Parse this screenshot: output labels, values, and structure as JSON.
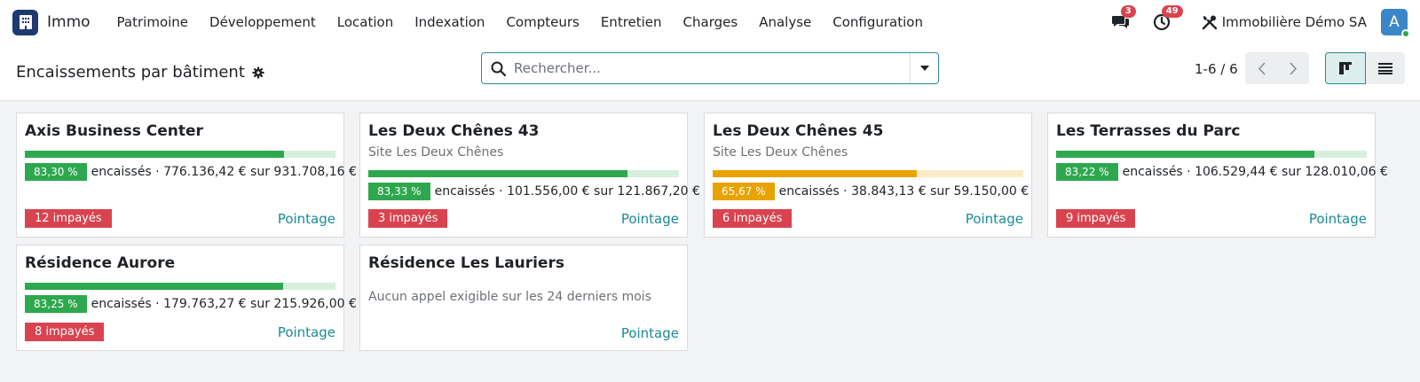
{
  "app": {
    "name": "Immo",
    "menu": [
      "Patrimoine",
      "Développement",
      "Location",
      "Indexation",
      "Compteurs",
      "Entretien",
      "Charges",
      "Analyse",
      "Configuration"
    ],
    "messages_count": "3",
    "activities_count": "49",
    "company": "Immobilière Démo SA",
    "avatar_letter": "A"
  },
  "control": {
    "title": "Encaissements par bâtiment",
    "search_placeholder": "Rechercher...",
    "pager": "1-6 / 6"
  },
  "colors": {
    "green": "#2ea84e",
    "green_light": "#d7efdc",
    "orange": "#e8a300",
    "orange_light": "#fcebc7",
    "red": "#d9434f",
    "teal": "#1a8a94"
  },
  "cards": [
    {
      "title": "Axis Business Center",
      "subtitle": "",
      "percent": 83.3,
      "percent_label": "83,30 %",
      "status": "green",
      "text": "encaissés · 776.136,42 € sur 931.708,16 €",
      "unpaid": "12 impayés",
      "link": "Pointage"
    },
    {
      "title": "Les Deux Chênes 43",
      "subtitle": "Site Les Deux Chênes",
      "percent": 83.33,
      "percent_label": "83,33 %",
      "status": "green",
      "text": "encaissés · 101.556,00 € sur 121.867,20 €",
      "unpaid": "3 impayés",
      "link": "Pointage"
    },
    {
      "title": "Les Deux Chênes 45",
      "subtitle": "Site Les Deux Chênes",
      "percent": 65.67,
      "percent_label": "65,67 %",
      "status": "orange",
      "text": "encaissés · 38.843,13 € sur 59.150,00 €",
      "unpaid": "6 impayés",
      "link": "Pointage"
    },
    {
      "title": "Les Terrasses du Parc",
      "subtitle": "",
      "percent": 83.22,
      "percent_label": "83,22 %",
      "status": "green",
      "text": "encaissés · 106.529,44 € sur 128.010,06 €",
      "unpaid": "9 impayés",
      "link": "Pointage"
    },
    {
      "title": "Résidence Aurore",
      "subtitle": "",
      "percent": 83.25,
      "percent_label": "83,25 %",
      "status": "green",
      "text": "encaissés · 179.763,27 € sur 215.926,00 €",
      "unpaid": "8 impayés",
      "link": "Pointage"
    },
    {
      "title": "Résidence Les Lauriers",
      "empty_text": "Aucun appel exigible sur les 24 derniers mois",
      "link": "Pointage"
    }
  ]
}
